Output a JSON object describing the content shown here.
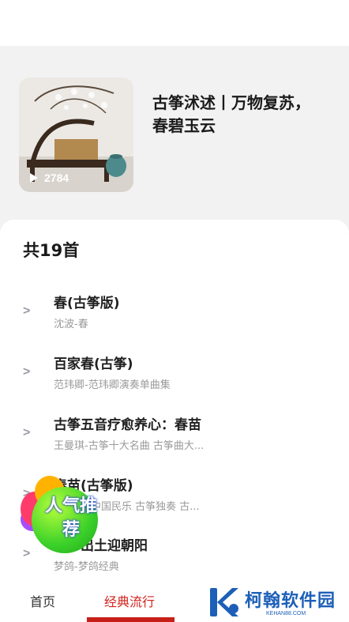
{
  "album": {
    "title": "古筝沭述丨万物复苏，春碧玉云",
    "play_count": "2784"
  },
  "list": {
    "count_label": "共19首",
    "chevron": ">",
    "songs": [
      {
        "name": "春(古筝版)",
        "meta": "沈波-春"
      },
      {
        "name": "百家春(古筝)",
        "meta": "范玮卿-范玮卿演奏单曲集"
      },
      {
        "name": "古筝五音疗愈养心：春苗",
        "meta": "王曼琪-古筝十大名曲 古筝曲大..."
      },
      {
        "name": "春苗(古筝版)",
        "meta": "中国民乐 古筝独奏 古..."
      },
      {
        "name": "春笋出土迎朝阳",
        "meta": "梦鸽-梦鸽经典"
      }
    ]
  },
  "badge": {
    "text": "人气推荐"
  },
  "tabs": {
    "home": "首页",
    "classic": "经典流行"
  },
  "brand": {
    "name": "柯翰软件园",
    "domain": "KEHAN88.COM"
  },
  "colors": {
    "accent": "#d2231c",
    "brand": "#1d5fb8"
  }
}
